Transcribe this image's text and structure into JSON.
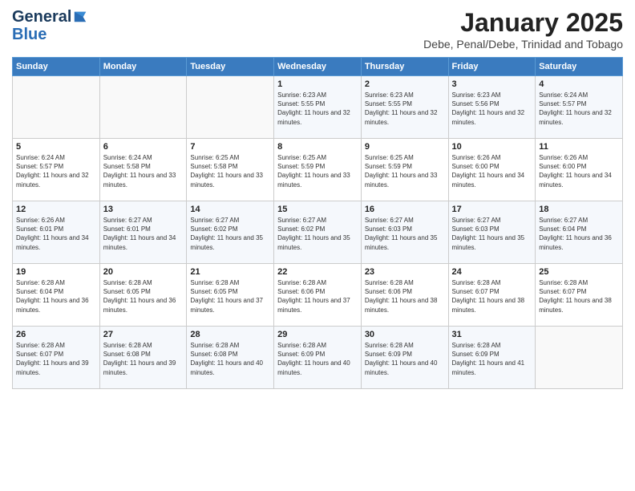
{
  "header": {
    "logo_line1": "General",
    "logo_line2": "Blue",
    "month": "January 2025",
    "location": "Debe, Penal/Debe, Trinidad and Tobago"
  },
  "days_of_week": [
    "Sunday",
    "Monday",
    "Tuesday",
    "Wednesday",
    "Thursday",
    "Friday",
    "Saturday"
  ],
  "weeks": [
    [
      {
        "day": "",
        "info": ""
      },
      {
        "day": "",
        "info": ""
      },
      {
        "day": "",
        "info": ""
      },
      {
        "day": "1",
        "info": "Sunrise: 6:23 AM\nSunset: 5:55 PM\nDaylight: 11 hours and 32 minutes."
      },
      {
        "day": "2",
        "info": "Sunrise: 6:23 AM\nSunset: 5:55 PM\nDaylight: 11 hours and 32 minutes."
      },
      {
        "day": "3",
        "info": "Sunrise: 6:23 AM\nSunset: 5:56 PM\nDaylight: 11 hours and 32 minutes."
      },
      {
        "day": "4",
        "info": "Sunrise: 6:24 AM\nSunset: 5:57 PM\nDaylight: 11 hours and 32 minutes."
      }
    ],
    [
      {
        "day": "5",
        "info": "Sunrise: 6:24 AM\nSunset: 5:57 PM\nDaylight: 11 hours and 32 minutes."
      },
      {
        "day": "6",
        "info": "Sunrise: 6:24 AM\nSunset: 5:58 PM\nDaylight: 11 hours and 33 minutes."
      },
      {
        "day": "7",
        "info": "Sunrise: 6:25 AM\nSunset: 5:58 PM\nDaylight: 11 hours and 33 minutes."
      },
      {
        "day": "8",
        "info": "Sunrise: 6:25 AM\nSunset: 5:59 PM\nDaylight: 11 hours and 33 minutes."
      },
      {
        "day": "9",
        "info": "Sunrise: 6:25 AM\nSunset: 5:59 PM\nDaylight: 11 hours and 33 minutes."
      },
      {
        "day": "10",
        "info": "Sunrise: 6:26 AM\nSunset: 6:00 PM\nDaylight: 11 hours and 34 minutes."
      },
      {
        "day": "11",
        "info": "Sunrise: 6:26 AM\nSunset: 6:00 PM\nDaylight: 11 hours and 34 minutes."
      }
    ],
    [
      {
        "day": "12",
        "info": "Sunrise: 6:26 AM\nSunset: 6:01 PM\nDaylight: 11 hours and 34 minutes."
      },
      {
        "day": "13",
        "info": "Sunrise: 6:27 AM\nSunset: 6:01 PM\nDaylight: 11 hours and 34 minutes."
      },
      {
        "day": "14",
        "info": "Sunrise: 6:27 AM\nSunset: 6:02 PM\nDaylight: 11 hours and 35 minutes."
      },
      {
        "day": "15",
        "info": "Sunrise: 6:27 AM\nSunset: 6:02 PM\nDaylight: 11 hours and 35 minutes."
      },
      {
        "day": "16",
        "info": "Sunrise: 6:27 AM\nSunset: 6:03 PM\nDaylight: 11 hours and 35 minutes."
      },
      {
        "day": "17",
        "info": "Sunrise: 6:27 AM\nSunset: 6:03 PM\nDaylight: 11 hours and 35 minutes."
      },
      {
        "day": "18",
        "info": "Sunrise: 6:27 AM\nSunset: 6:04 PM\nDaylight: 11 hours and 36 minutes."
      }
    ],
    [
      {
        "day": "19",
        "info": "Sunrise: 6:28 AM\nSunset: 6:04 PM\nDaylight: 11 hours and 36 minutes."
      },
      {
        "day": "20",
        "info": "Sunrise: 6:28 AM\nSunset: 6:05 PM\nDaylight: 11 hours and 36 minutes."
      },
      {
        "day": "21",
        "info": "Sunrise: 6:28 AM\nSunset: 6:05 PM\nDaylight: 11 hours and 37 minutes."
      },
      {
        "day": "22",
        "info": "Sunrise: 6:28 AM\nSunset: 6:06 PM\nDaylight: 11 hours and 37 minutes."
      },
      {
        "day": "23",
        "info": "Sunrise: 6:28 AM\nSunset: 6:06 PM\nDaylight: 11 hours and 38 minutes."
      },
      {
        "day": "24",
        "info": "Sunrise: 6:28 AM\nSunset: 6:07 PM\nDaylight: 11 hours and 38 minutes."
      },
      {
        "day": "25",
        "info": "Sunrise: 6:28 AM\nSunset: 6:07 PM\nDaylight: 11 hours and 38 minutes."
      }
    ],
    [
      {
        "day": "26",
        "info": "Sunrise: 6:28 AM\nSunset: 6:07 PM\nDaylight: 11 hours and 39 minutes."
      },
      {
        "day": "27",
        "info": "Sunrise: 6:28 AM\nSunset: 6:08 PM\nDaylight: 11 hours and 39 minutes."
      },
      {
        "day": "28",
        "info": "Sunrise: 6:28 AM\nSunset: 6:08 PM\nDaylight: 11 hours and 40 minutes."
      },
      {
        "day": "29",
        "info": "Sunrise: 6:28 AM\nSunset: 6:09 PM\nDaylight: 11 hours and 40 minutes."
      },
      {
        "day": "30",
        "info": "Sunrise: 6:28 AM\nSunset: 6:09 PM\nDaylight: 11 hours and 40 minutes."
      },
      {
        "day": "31",
        "info": "Sunrise: 6:28 AM\nSunset: 6:09 PM\nDaylight: 11 hours and 41 minutes."
      },
      {
        "day": "",
        "info": ""
      }
    ]
  ]
}
